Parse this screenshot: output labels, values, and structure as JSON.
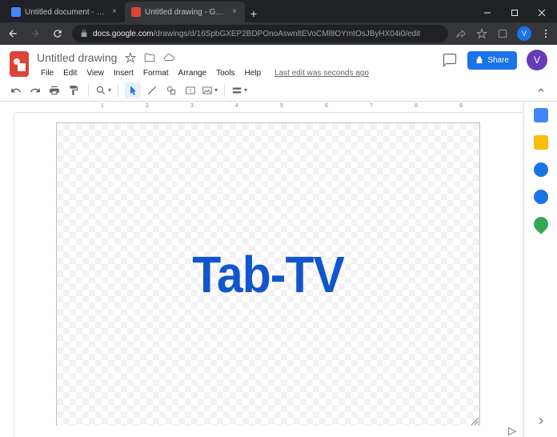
{
  "browser": {
    "tabs": [
      {
        "title": "Untitled document - Google Do",
        "favicon_color": "#4285f4"
      },
      {
        "title": "Untitled drawing - Google Draw",
        "favicon_color": "#db4437"
      }
    ],
    "url_host": "docs.google.com",
    "url_path": "/drawings/d/16SpbGXEP2BDPOnoAswnltEVoCMl8OYmtOsJByHX04i0/edit",
    "avatar_letter": "V"
  },
  "app": {
    "logo_color": "#db4437",
    "doc_title": "Untitled drawing",
    "menus": [
      "File",
      "Edit",
      "View",
      "Insert",
      "Format",
      "Arrange",
      "Tools",
      "Help"
    ],
    "last_edit": "Last edit was seconds ago",
    "share_label": "Share",
    "avatar_letter": "V"
  },
  "ruler": {
    "marks": [
      "1",
      "2",
      "3",
      "4",
      "5",
      "6",
      "7",
      "8",
      "9"
    ]
  },
  "canvas": {
    "text": "Tab-TV",
    "text_color": "#1155cc"
  },
  "side_panel": {
    "icons": [
      {
        "name": "calendar-icon",
        "color": "#4285f4"
      },
      {
        "name": "keep-icon",
        "color": "#fbbc04"
      },
      {
        "name": "tasks-icon",
        "color": "#1a73e8"
      },
      {
        "name": "contacts-icon",
        "color": "#1a73e8"
      },
      {
        "name": "maps-icon",
        "color": "#34a853"
      }
    ]
  }
}
